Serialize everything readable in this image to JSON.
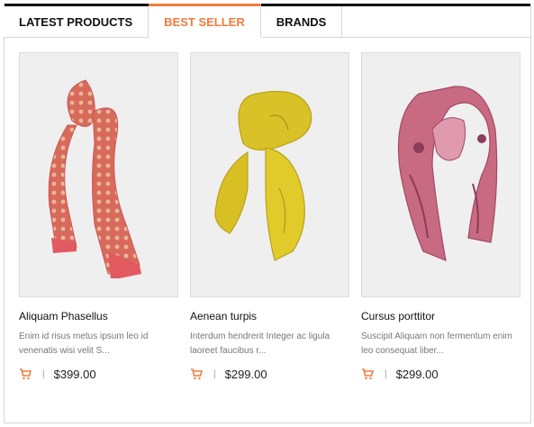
{
  "tabs": [
    {
      "label": "LATEST PRODUCTS",
      "active": false
    },
    {
      "label": "BEST SELLER",
      "active": true
    },
    {
      "label": "BRANDS",
      "active": false
    }
  ],
  "colors": {
    "accent": "#f07b3c",
    "topbar": "#111111"
  },
  "products": [
    {
      "name": "Aliquam Phasellus",
      "description": "Enim id risus metus ipsum leo id venenatis wisi velit S...",
      "price": "$399.00",
      "icon": "cart-icon",
      "separator": "|"
    },
    {
      "name": "Aenean turpis",
      "description": "Interdum hendrerit Integer ac ligula laoreet faucibus r...",
      "price": "$299.00",
      "icon": "cart-icon",
      "separator": "|"
    },
    {
      "name": "Cursus porttitor",
      "description": "Suscipit Aliquam non fermentum enim leo consequat liber...",
      "price": "$299.00",
      "icon": "cart-icon",
      "separator": "|"
    }
  ]
}
